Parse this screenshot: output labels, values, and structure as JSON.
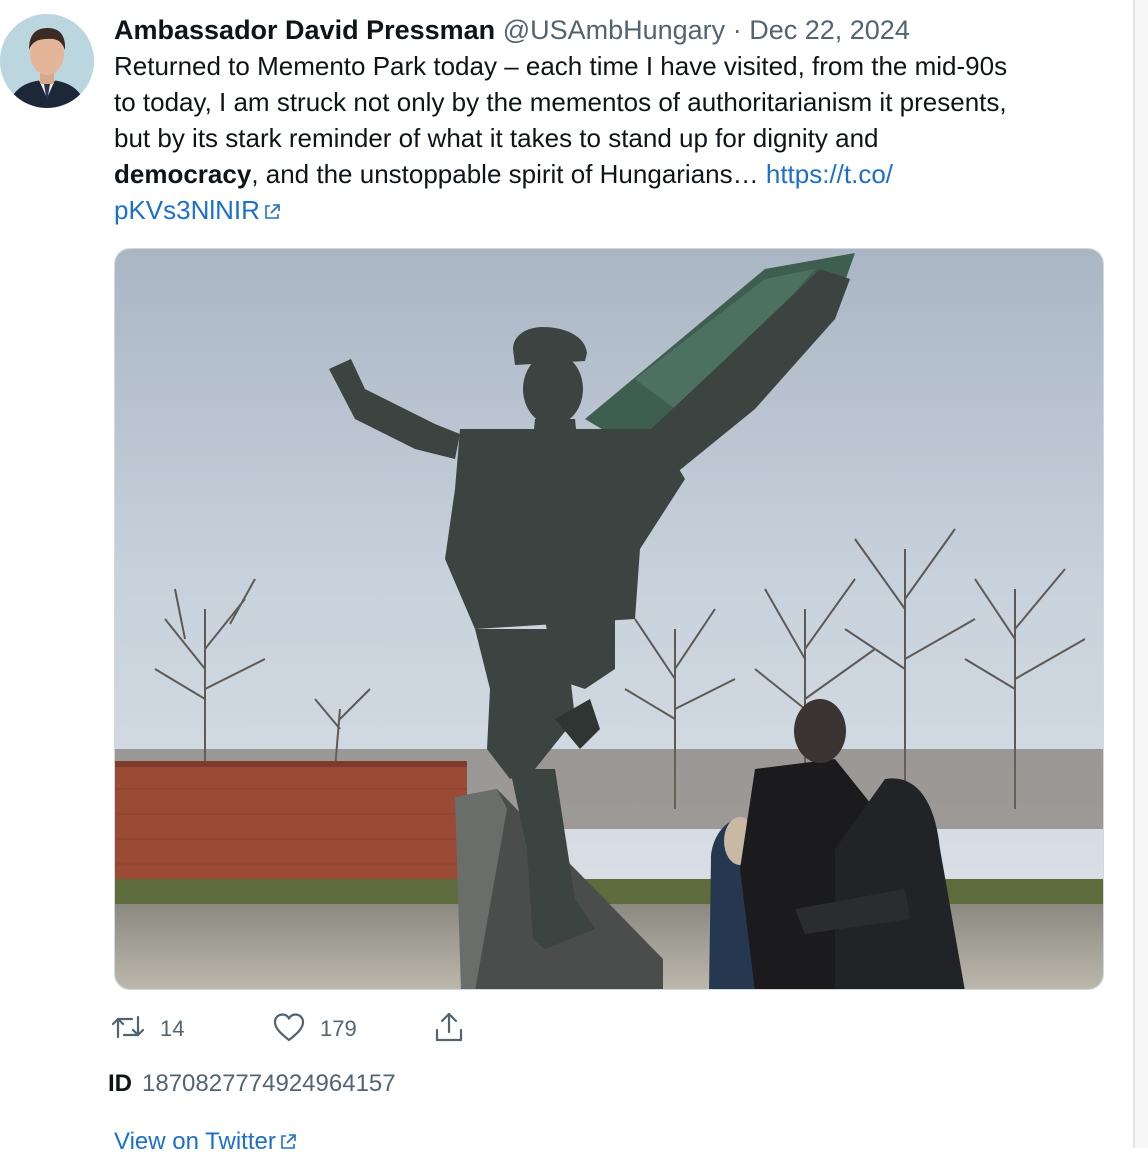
{
  "tweet": {
    "author_name": "Ambassador David Pressman",
    "handle": "@USAmbHungary",
    "separator": "·",
    "date": "Dec 22, 2024",
    "text_lines": [
      "Returned to Memento Park today – each time I have visited, from the mid-90s",
      "to today, I am struck not only by the mementos of authoritarianism it presents,",
      "but by its stark reminder of what it takes to stand up for dignity and"
    ],
    "text_bold_word": "democracy",
    "text_tail": ", and the unstoppable spirit of Hungarians… ",
    "link_part1": "https://t.co/",
    "link_part2": "pKVs3NlNIR",
    "media_description_icon": "photo",
    "retweet_count": "14",
    "like_count": "179",
    "id_label": "ID",
    "id_value": "1870827774924964157",
    "view_link": "View on Twitter"
  },
  "icons": {
    "retweet": "retweet-icon",
    "like": "heart-icon",
    "share": "share-icon",
    "external": "external-link-icon"
  },
  "colors": {
    "text": "#0f1419",
    "secondary": "#536471",
    "link": "#1d70c9"
  }
}
